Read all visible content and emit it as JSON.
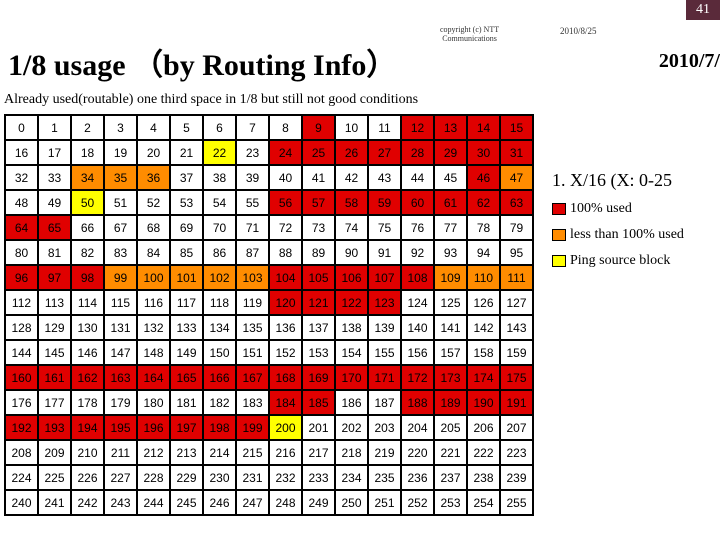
{
  "page_number": "41",
  "copyright_line1": "copyright (c) NTT",
  "copyright_line2": "Communications",
  "date_small": "2010/8/25",
  "date_large": "2010/7/",
  "title": "1/8 usage （by Routing Info）",
  "subtitle": "Already used(routable) one third space in 1/8 but still not good conditions",
  "annotation1": "1. X/16 (X: 0-25",
  "legend_red": "100% used",
  "legend_orange": "less than 100% used",
  "legend_yellow": "Ping source block",
  "chart_data": {
    "type": "heatmap",
    "title": "1/8 usage by Routing Info",
    "xlabel": "",
    "ylabel": "",
    "xlim": [
      0,
      15
    ],
    "ylim": [
      0,
      15
    ],
    "categories_note": "cells represent /16 blocks 0-255",
    "series": [
      {
        "name": "red (100% used)",
        "values": [
          9,
          12,
          13,
          14,
          15,
          24,
          25,
          26,
          27,
          28,
          29,
          30,
          31,
          46,
          56,
          57,
          58,
          59,
          60,
          61,
          62,
          63,
          64,
          65,
          96,
          97,
          98,
          104,
          105,
          106,
          107,
          108,
          120,
          121,
          122,
          123,
          160,
          161,
          162,
          163,
          164,
          165,
          166,
          167,
          168,
          169,
          170,
          171,
          172,
          173,
          174,
          175,
          184,
          185,
          188,
          189,
          190,
          191,
          192,
          193,
          194,
          195,
          196,
          197,
          198,
          199
        ]
      },
      {
        "name": "orange (less than 100% used)",
        "values": [
          34,
          35,
          36,
          47,
          99,
          100,
          101,
          102,
          103,
          109,
          110,
          111
        ]
      },
      {
        "name": "yellow (Ping source block)",
        "values": [
          22,
          50,
          200
        ]
      },
      {
        "name": "white (unused)",
        "values_note": "all remaining 0-255"
      }
    ]
  }
}
